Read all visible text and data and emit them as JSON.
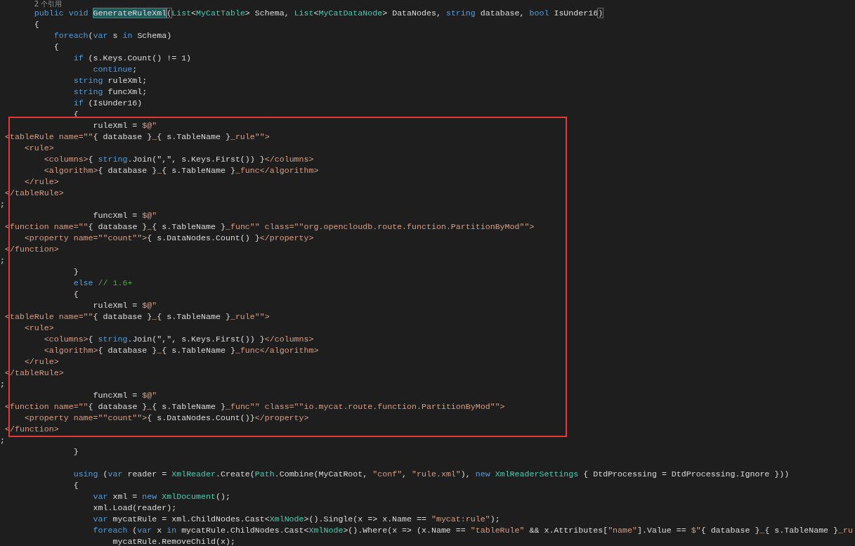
{
  "editor": {
    "blocks": [
      {
        "boxed": false,
        "lines": [
          {
            "kind": "codelens",
            "text": "       2 个引用"
          },
          {
            "kind": "code",
            "tokens": [
              {
                "kind": "keyword",
                "text": "       public void "
              },
              {
                "kind": "symbol",
                "text": "GenerateRuleXml"
              },
              {
                "kind": "brace",
                "text": "("
              },
              {
                "kind": "type",
                "text": "List"
              },
              {
                "kind": "plain",
                "text": "<"
              },
              {
                "kind": "type",
                "text": "MyCatTable"
              },
              {
                "kind": "plain",
                "text": "> Schema, "
              },
              {
                "kind": "type",
                "text": "List"
              },
              {
                "kind": "plain",
                "text": "<"
              },
              {
                "kind": "type",
                "text": "MyCatDataNode"
              },
              {
                "kind": "plain",
                "text": "> DataNodes, "
              },
              {
                "kind": "keyword",
                "text": "string"
              },
              {
                "kind": "plain",
                "text": " database, "
              },
              {
                "kind": "keyword",
                "text": "bool"
              },
              {
                "kind": "plain",
                "text": " IsUnder16"
              },
              {
                "kind": "brace",
                "text": ")"
              }
            ]
          },
          {
            "kind": "code",
            "tokens": [
              {
                "kind": "plain",
                "text": "       {"
              }
            ]
          },
          {
            "kind": "code",
            "tokens": [
              {
                "kind": "keyword",
                "text": "           foreach"
              },
              {
                "kind": "plain",
                "text": "("
              },
              {
                "kind": "keyword",
                "text": "var"
              },
              {
                "kind": "plain",
                "text": " s "
              },
              {
                "kind": "keyword",
                "text": "in"
              },
              {
                "kind": "plain",
                "text": " Schema)"
              }
            ]
          },
          {
            "kind": "code",
            "tokens": [
              {
                "kind": "plain",
                "text": "           {"
              }
            ]
          },
          {
            "kind": "code",
            "tokens": [
              {
                "kind": "keyword",
                "text": "               if"
              },
              {
                "kind": "plain",
                "text": " (s.Keys.Count() != 1)"
              }
            ]
          },
          {
            "kind": "code",
            "tokens": [
              {
                "kind": "keyword",
                "text": "                   continue"
              },
              {
                "kind": "plain",
                "text": ";"
              }
            ]
          },
          {
            "kind": "code",
            "tokens": [
              {
                "kind": "keyword",
                "text": "               string"
              },
              {
                "kind": "plain",
                "text": " ruleXml;"
              }
            ]
          },
          {
            "kind": "code",
            "tokens": [
              {
                "kind": "keyword",
                "text": "               string"
              },
              {
                "kind": "plain",
                "text": " funcXml;"
              }
            ]
          },
          {
            "kind": "code",
            "tokens": [
              {
                "kind": "keyword",
                "text": "               if"
              },
              {
                "kind": "plain",
                "text": " (IsUnder16)"
              }
            ]
          },
          {
            "kind": "code",
            "tokens": [
              {
                "kind": "plain",
                "text": "               {"
              }
            ]
          }
        ]
      },
      {
        "boxed": true,
        "lines": [
          {
            "kind": "code",
            "tokens": [
              {
                "kind": "plain",
                "text": "                   ruleXml = "
              },
              {
                "kind": "string",
                "text": "$@\""
              }
            ]
          },
          {
            "kind": "code",
            "tokens": [
              {
                "kind": "string",
                "text": " <tableRule name=\"\""
              },
              {
                "kind": "plain",
                "text": "{ database }"
              },
              {
                "kind": "string",
                "text": "_"
              },
              {
                "kind": "plain",
                "text": "{ s.TableName }"
              },
              {
                "kind": "string",
                "text": "_rule\"\">"
              }
            ]
          },
          {
            "kind": "code",
            "tokens": [
              {
                "kind": "string",
                "text": "     <rule>"
              }
            ]
          },
          {
            "kind": "code",
            "tokens": [
              {
                "kind": "string",
                "text": "         <columns>"
              },
              {
                "kind": "plain",
                "text": "{ "
              },
              {
                "kind": "keyword",
                "text": "string"
              },
              {
                "kind": "plain",
                "text": ".Join(\",\", s.Keys.First()) }"
              },
              {
                "kind": "string",
                "text": "</columns>"
              }
            ]
          },
          {
            "kind": "code",
            "tokens": [
              {
                "kind": "string",
                "text": "         <algorithm>"
              },
              {
                "kind": "plain",
                "text": "{ database }"
              },
              {
                "kind": "string",
                "text": "_"
              },
              {
                "kind": "plain",
                "text": "{ s.TableName }"
              },
              {
                "kind": "string",
                "text": "_func</algorithm>"
              }
            ]
          },
          {
            "kind": "code",
            "tokens": [
              {
                "kind": "string",
                "text": "     </rule>"
              }
            ]
          },
          {
            "kind": "code",
            "tokens": [
              {
                "kind": "string",
                "text": " </tableRule>"
              }
            ]
          },
          {
            "kind": "code",
            "tokens": [
              {
                "kind": "plain",
                "text": ";"
              }
            ]
          },
          {
            "kind": "code",
            "tokens": [
              {
                "kind": "plain",
                "text": "                   funcXml = "
              },
              {
                "kind": "string",
                "text": "$@\""
              }
            ]
          },
          {
            "kind": "code",
            "tokens": [
              {
                "kind": "string",
                "text": " <function name=\"\""
              },
              {
                "kind": "plain",
                "text": "{ database }"
              },
              {
                "kind": "string",
                "text": "_"
              },
              {
                "kind": "plain",
                "text": "{ s.TableName }"
              },
              {
                "kind": "string",
                "text": "_func\"\" class=\"\"org.opencloudb.route.function.PartitionByMod\"\">"
              }
            ]
          },
          {
            "kind": "code",
            "tokens": [
              {
                "kind": "string",
                "text": "     <property name=\"\"count\"\">"
              },
              {
                "kind": "plain",
                "text": "{ s.DataNodes.Count() }"
              },
              {
                "kind": "string",
                "text": "</property>"
              }
            ]
          },
          {
            "kind": "code",
            "tokens": [
              {
                "kind": "string",
                "text": " </function>"
              }
            ]
          },
          {
            "kind": "code",
            "tokens": [
              {
                "kind": "plain",
                "text": ";"
              }
            ]
          },
          {
            "kind": "code",
            "tokens": [
              {
                "kind": "plain",
                "text": "               }"
              }
            ]
          },
          {
            "kind": "code",
            "tokens": [
              {
                "kind": "keyword",
                "text": "               else"
              },
              {
                "kind": "comment",
                "text": " // 1.6+"
              }
            ]
          },
          {
            "kind": "code",
            "tokens": [
              {
                "kind": "plain",
                "text": "               {"
              }
            ]
          },
          {
            "kind": "code",
            "tokens": [
              {
                "kind": "plain",
                "text": "                   ruleXml = "
              },
              {
                "kind": "string",
                "text": "$@\""
              }
            ]
          },
          {
            "kind": "code",
            "tokens": [
              {
                "kind": "string",
                "text": " <tableRule name=\"\""
              },
              {
                "kind": "plain",
                "text": "{ database }"
              },
              {
                "kind": "string",
                "text": "_"
              },
              {
                "kind": "plain",
                "text": "{ s.TableName }"
              },
              {
                "kind": "string",
                "text": "_rule\"\">"
              }
            ]
          },
          {
            "kind": "code",
            "tokens": [
              {
                "kind": "string",
                "text": "     <rule>"
              }
            ]
          },
          {
            "kind": "code",
            "tokens": [
              {
                "kind": "string",
                "text": "         <columns>"
              },
              {
                "kind": "plain",
                "text": "{ "
              },
              {
                "kind": "keyword",
                "text": "string"
              },
              {
                "kind": "plain",
                "text": ".Join(\",\", s.Keys.First()) }"
              },
              {
                "kind": "string",
                "text": "</columns>"
              }
            ]
          },
          {
            "kind": "code",
            "tokens": [
              {
                "kind": "string",
                "text": "         <algorithm>"
              },
              {
                "kind": "plain",
                "text": "{ database }"
              },
              {
                "kind": "string",
                "text": "_"
              },
              {
                "kind": "plain",
                "text": "{ s.TableName }"
              },
              {
                "kind": "string",
                "text": "_func</algorithm>"
              }
            ]
          },
          {
            "kind": "code",
            "tokens": [
              {
                "kind": "string",
                "text": "     </rule>"
              }
            ]
          },
          {
            "kind": "code",
            "tokens": [
              {
                "kind": "string",
                "text": " </tableRule>"
              }
            ]
          },
          {
            "kind": "code",
            "tokens": [
              {
                "kind": "plain",
                "text": ";"
              }
            ]
          },
          {
            "kind": "code",
            "tokens": [
              {
                "kind": "plain",
                "text": "                   funcXml = "
              },
              {
                "kind": "string",
                "text": "$@\""
              }
            ]
          },
          {
            "kind": "code",
            "tokens": [
              {
                "kind": "string",
                "text": " <function name=\"\""
              },
              {
                "kind": "plain",
                "text": "{ database }"
              },
              {
                "kind": "string",
                "text": "_"
              },
              {
                "kind": "plain",
                "text": "{ s.TableName }"
              },
              {
                "kind": "string",
                "text": "_func\"\" class=\"\"io.mycat.route.function.PartitionByMod\"\">"
              }
            ]
          },
          {
            "kind": "code",
            "tokens": [
              {
                "kind": "string",
                "text": "     <property name=\"\"count\"\">"
              },
              {
                "kind": "plain",
                "text": "{ s.DataNodes.Count()}"
              },
              {
                "kind": "string",
                "text": "</property>"
              }
            ]
          },
          {
            "kind": "code",
            "tokens": [
              {
                "kind": "string",
                "text": " </function>"
              }
            ]
          }
        ]
      },
      {
        "boxed": false,
        "lines": [
          {
            "kind": "code",
            "tokens": [
              {
                "kind": "plain",
                "text": ";"
              }
            ]
          },
          {
            "kind": "code",
            "tokens": [
              {
                "kind": "plain",
                "text": "               }"
              }
            ]
          },
          {
            "kind": "blank"
          },
          {
            "kind": "code",
            "tokens": [
              {
                "kind": "keyword",
                "text": "               using"
              },
              {
                "kind": "plain",
                "text": " ("
              },
              {
                "kind": "keyword",
                "text": "var"
              },
              {
                "kind": "plain",
                "text": " reader = "
              },
              {
                "kind": "type",
                "text": "XmlReader"
              },
              {
                "kind": "plain",
                "text": ".Create("
              },
              {
                "kind": "type",
                "text": "Path"
              },
              {
                "kind": "plain",
                "text": ".Combine(MyCatRoot, "
              },
              {
                "kind": "string",
                "text": "\"conf\""
              },
              {
                "kind": "plain",
                "text": ", "
              },
              {
                "kind": "string",
                "text": "\"rule.xml\""
              },
              {
                "kind": "plain",
                "text": "), "
              },
              {
                "kind": "keyword",
                "text": "new"
              },
              {
                "kind": "type",
                "text": " XmlReaderSettings"
              },
              {
                "kind": "plain",
                "text": " { DtdProcessing = DtdProcessing.Ignore }))"
              }
            ]
          },
          {
            "kind": "code",
            "tokens": [
              {
                "kind": "plain",
                "text": "               {"
              }
            ]
          },
          {
            "kind": "code",
            "tokens": [
              {
                "kind": "keyword",
                "text": "                   var"
              },
              {
                "kind": "plain",
                "text": " xml = "
              },
              {
                "kind": "keyword",
                "text": "new"
              },
              {
                "kind": "type",
                "text": " XmlDocument"
              },
              {
                "kind": "plain",
                "text": "();"
              }
            ]
          },
          {
            "kind": "code",
            "tokens": [
              {
                "kind": "plain",
                "text": "                   xml.Load(reader);"
              }
            ]
          },
          {
            "kind": "code",
            "tokens": [
              {
                "kind": "keyword",
                "text": "                   var"
              },
              {
                "kind": "plain",
                "text": " mycatRule = xml.ChildNodes.Cast<"
              },
              {
                "kind": "type",
                "text": "XmlNode"
              },
              {
                "kind": "plain",
                "text": ">().Single(x => x.Name == "
              },
              {
                "kind": "string",
                "text": "\"mycat:rule\""
              },
              {
                "kind": "plain",
                "text": ");"
              }
            ]
          },
          {
            "kind": "code",
            "tokens": [
              {
                "kind": "keyword",
                "text": "                   foreach"
              },
              {
                "kind": "plain",
                "text": " ("
              },
              {
                "kind": "keyword",
                "text": "var"
              },
              {
                "kind": "plain",
                "text": " x "
              },
              {
                "kind": "keyword",
                "text": "in"
              },
              {
                "kind": "plain",
                "text": " mycatRule.ChildNodes.Cast<"
              },
              {
                "kind": "type",
                "text": "XmlNode"
              },
              {
                "kind": "plain",
                "text": ">().Where(x => (x.Name == "
              },
              {
                "kind": "string",
                "text": "\"tableRule\""
              },
              {
                "kind": "plain",
                "text": " && x.Attributes["
              },
              {
                "kind": "string",
                "text": "\"name\""
              },
              {
                "kind": "plain",
                "text": "].Value == "
              },
              {
                "kind": "string",
                "text": "$\""
              },
              {
                "kind": "plain",
                "text": "{ database }"
              },
              {
                "kind": "string",
                "text": "_"
              },
              {
                "kind": "plain",
                "text": "{ s.TableName }"
              },
              {
                "kind": "string",
                "text": "_ru"
              }
            ]
          },
          {
            "kind": "code",
            "tokens": [
              {
                "kind": "plain",
                "text": "                       mycatRule.RemoveChild(x);"
              }
            ]
          }
        ]
      }
    ]
  }
}
